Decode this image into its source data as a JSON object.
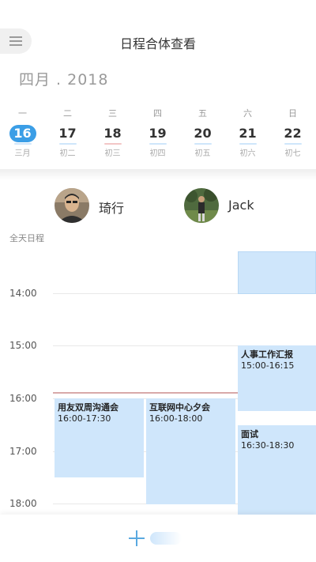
{
  "header": {
    "title": "日程合体查看"
  },
  "month_label": "四月 . 2018",
  "week": [
    {
      "weekday": "一",
      "date": "16",
      "lunar": "三月",
      "selected": true,
      "mark": "#cfe6fb"
    },
    {
      "weekday": "二",
      "date": "17",
      "lunar": "初二",
      "selected": false,
      "mark": "#cfe6fb"
    },
    {
      "weekday": "三",
      "date": "18",
      "lunar": "初三",
      "selected": false,
      "mark": "#f3c6c6"
    },
    {
      "weekday": "四",
      "date": "19",
      "lunar": "初四",
      "selected": false,
      "mark": "#cfe6fb"
    },
    {
      "weekday": "五",
      "date": "20",
      "lunar": "初五",
      "selected": false,
      "mark": "#cfe6fb"
    },
    {
      "weekday": "六",
      "date": "21",
      "lunar": "初六",
      "selected": false,
      "mark": "#cfe6fb"
    },
    {
      "weekday": "日",
      "date": "22",
      "lunar": "初七",
      "selected": false,
      "mark": "#cfe6fb"
    }
  ],
  "people": [
    {
      "name": "琦行"
    },
    {
      "name": "Jack"
    }
  ],
  "all_day_label": "全天日程",
  "hours": [
    "14:00",
    "15:00",
    "16:00",
    "17:00",
    "18:00"
  ],
  "events": [
    {
      "title": "人事工作汇报",
      "time": "15:00-16:15"
    },
    {
      "title": "用友双周沟通会",
      "time": "16:00-17:30"
    },
    {
      "title": "互联网中心夕会",
      "time": "16:00-18:00"
    },
    {
      "title": "面试",
      "time": "16:30-18:30"
    }
  ],
  "colors": {
    "accent": "#3b9ee6",
    "event_fill": "#cfe6fb",
    "now_line": "#d8a9a9"
  }
}
